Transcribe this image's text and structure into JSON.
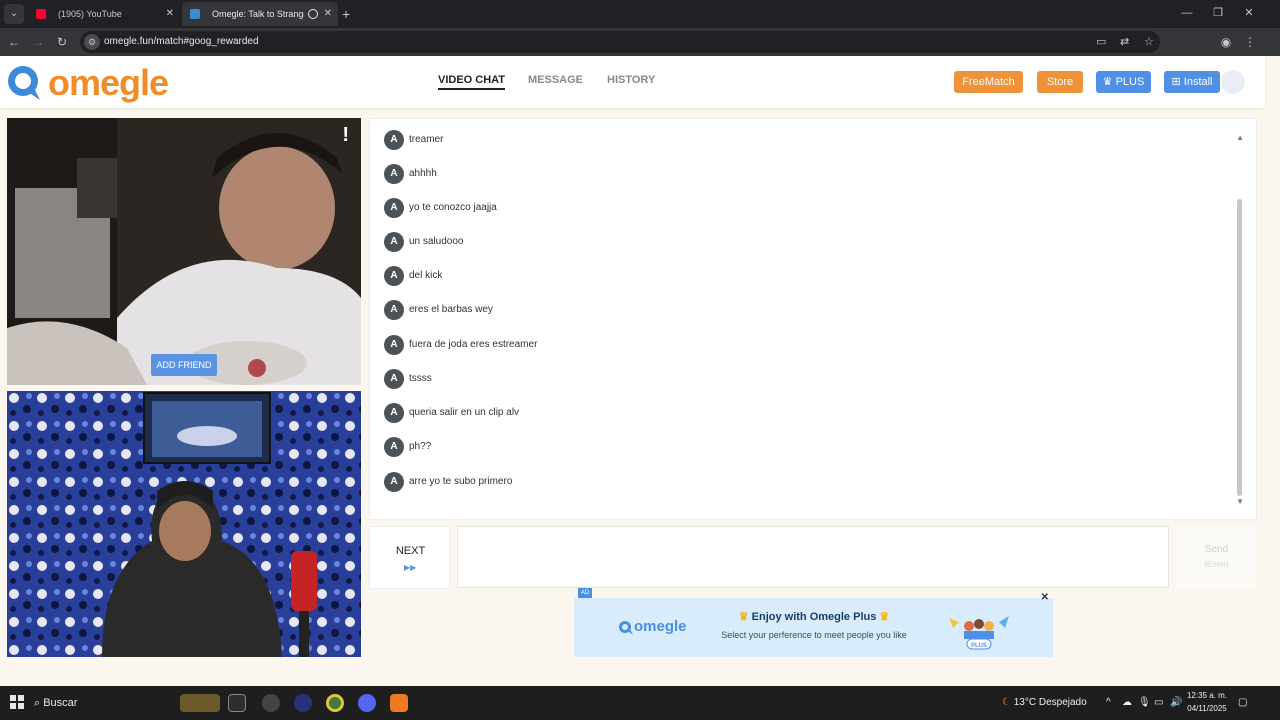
{
  "browser": {
    "tabs": [
      {
        "label": "(1905) YouTube",
        "favicon": "youtube-icon"
      },
      {
        "label": "Omegle: Talk to Strangers v",
        "favicon": "omegle-icon",
        "active": true
      }
    ],
    "url": "omegle.fun/match#goog_rewarded"
  },
  "header": {
    "logo_text": "omegle",
    "nav": [
      {
        "label": "VIDEO CHAT",
        "active": true
      },
      {
        "label": "MESSAGE"
      },
      {
        "label": "HISTORY"
      }
    ],
    "buttons": {
      "freematch": "FreeMatch",
      "store": "Store",
      "plus": "PLUS",
      "install": "Install"
    }
  },
  "video": {
    "report_label": "!",
    "add_friend": "ADD FRIEND"
  },
  "chat": {
    "sender_badge": "A",
    "messages": [
      "treamer",
      "ahhhh",
      "yo te conozco jaajja",
      "un saludooo",
      "del kick",
      "eres el barbas wey",
      "fuera de joda eres estreamer",
      "tssss",
      "queria salir en un clip alv",
      "ph??",
      "arre yo te subo primero"
    ]
  },
  "controls": {
    "next_label": "NEXT",
    "send_label": "Send",
    "send_hint": "(Enter)"
  },
  "ad": {
    "badge": "AD",
    "logo_text": "omegle",
    "title": "Enjoy with Omegle Plus",
    "subtitle": "Select your perference to meet people you like",
    "art_badge": "PLUS"
  },
  "taskbar": {
    "search": "Buscar",
    "weather": "13°C  Despejado",
    "time": "12:35 a. m.",
    "date": "04/11/2025"
  },
  "colors": {
    "accent_orange": "#f0923a",
    "accent_blue": "#4f8fe6",
    "logo_orange": "#f28c28",
    "page_bg": "#fbf7ef"
  }
}
